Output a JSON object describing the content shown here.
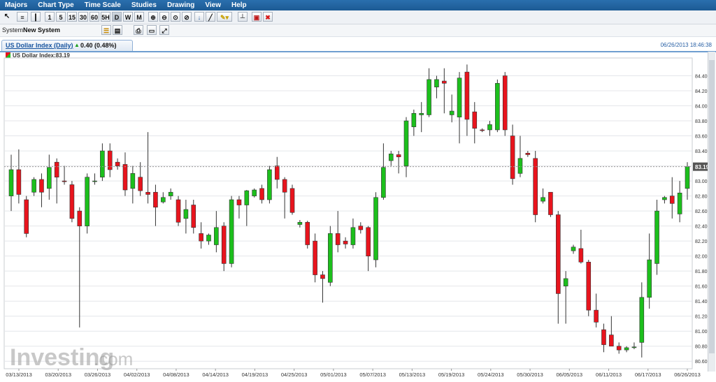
{
  "menu": [
    "Majors",
    "Chart Type",
    "Time Scale",
    "Studies",
    "Drawing",
    "View",
    "Help"
  ],
  "toolbar": {
    "periods": [
      "1",
      "5",
      "15",
      "30",
      "60",
      "5H",
      "D",
      "W",
      "M"
    ],
    "selected_period": "D"
  },
  "system": {
    "label": "System:",
    "value": "New System"
  },
  "tab": {
    "instrument": "US Dollar Index (Daily)",
    "change": "0.40 (0.48%)",
    "timestamp": "06/26/2013 18:46:38"
  },
  "legend": {
    "text": "US Dollar Index:83.19"
  },
  "watermark": {
    "brand": "Investing",
    "domain": ".com"
  },
  "colors": {
    "up": "#1cbf1c",
    "down": "#e8141d",
    "accent": "#1a56a0",
    "current_line": "#9a9a9a",
    "label_bg": "#555555"
  },
  "chart_data": {
    "type": "candlestick",
    "current_value": 83.19,
    "current_label": "83.19",
    "ylim": [
      80.5,
      84.6
    ],
    "y_ticks": [
      "84.40",
      "84.20",
      "84.00",
      "83.80",
      "83.60",
      "83.40",
      "83.20",
      "83.00",
      "82.80",
      "82.60",
      "82.40",
      "82.20",
      "82.00",
      "81.80",
      "81.60",
      "81.40",
      "81.20",
      "81.00",
      "80.80",
      "80.60"
    ],
    "x_ticks": [
      "03/13/2013",
      "03/20/2013",
      "03/26/2013",
      "04/02/2013",
      "04/08/2013",
      "04/14/2013",
      "04/19/2013",
      "04/25/2013",
      "05/01/2013",
      "05/07/2013",
      "05/13/2013",
      "05/19/2013",
      "05/24/2013",
      "05/30/2013",
      "06/05/2013",
      "06/11/2013",
      "06/17/2013",
      "06/26/2013"
    ],
    "candles": [
      {
        "o": 82.8,
        "h": 83.35,
        "l": 82.6,
        "c": 83.15
      },
      {
        "o": 83.15,
        "h": 83.42,
        "l": 82.7,
        "c": 82.82
      },
      {
        "o": 82.75,
        "h": 82.8,
        "l": 82.25,
        "c": 82.3
      },
      {
        "o": 82.85,
        "h": 83.05,
        "l": 82.8,
        "c": 83.02
      },
      {
        "o": 83.02,
        "h": 83.1,
        "l": 82.65,
        "c": 82.85
      },
      {
        "o": 82.9,
        "h": 83.35,
        "l": 82.75,
        "c": 83.18
      },
      {
        "o": 83.25,
        "h": 83.3,
        "l": 82.7,
        "c": 83.05
      },
      {
        "o": 83.0,
        "h": 83.2,
        "l": 82.95,
        "c": 82.99
      },
      {
        "o": 82.95,
        "h": 83.0,
        "l": 82.45,
        "c": 82.5
      },
      {
        "o": 82.6,
        "h": 82.65,
        "l": 81.05,
        "c": 82.4
      },
      {
        "o": 82.4,
        "h": 83.1,
        "l": 82.3,
        "c": 83.05
      },
      {
        "o": 83.0,
        "h": 83.1,
        "l": 82.95,
        "c": 83.0
      },
      {
        "o": 83.05,
        "h": 83.5,
        "l": 83.0,
        "c": 83.4
      },
      {
        "o": 83.4,
        "h": 83.5,
        "l": 83.05,
        "c": 83.15
      },
      {
        "o": 83.25,
        "h": 83.3,
        "l": 83.15,
        "c": 83.2
      },
      {
        "o": 83.22,
        "h": 83.38,
        "l": 82.8,
        "c": 82.88
      },
      {
        "o": 82.9,
        "h": 83.2,
        "l": 82.7,
        "c": 83.1
      },
      {
        "o": 83.05,
        "h": 83.25,
        "l": 82.8,
        "c": 82.87
      },
      {
        "o": 82.85,
        "h": 83.65,
        "l": 82.7,
        "c": 82.82
      },
      {
        "o": 82.85,
        "h": 82.95,
        "l": 82.4,
        "c": 82.65
      },
      {
        "o": 82.72,
        "h": 82.85,
        "l": 82.7,
        "c": 82.78
      },
      {
        "o": 82.8,
        "h": 82.9,
        "l": 82.75,
        "c": 82.85
      },
      {
        "o": 82.75,
        "h": 82.8,
        "l": 82.4,
        "c": 82.45
      },
      {
        "o": 82.5,
        "h": 82.75,
        "l": 82.3,
        "c": 82.62
      },
      {
        "o": 82.68,
        "h": 82.75,
        "l": 82.3,
        "c": 82.38
      },
      {
        "o": 82.3,
        "h": 82.45,
        "l": 82.1,
        "c": 82.2
      },
      {
        "o": 82.2,
        "h": 82.3,
        "l": 82.15,
        "c": 82.28
      },
      {
        "o": 82.15,
        "h": 82.6,
        "l": 82.05,
        "c": 82.38
      },
      {
        "o": 82.4,
        "h": 82.45,
        "l": 81.8,
        "c": 81.9
      },
      {
        "o": 81.9,
        "h": 82.8,
        "l": 81.85,
        "c": 82.75
      },
      {
        "o": 82.75,
        "h": 82.8,
        "l": 82.5,
        "c": 82.68
      },
      {
        "o": 82.68,
        "h": 82.88,
        "l": 82.4,
        "c": 82.87
      },
      {
        "o": 82.8,
        "h": 82.9,
        "l": 82.78,
        "c": 82.88
      },
      {
        "o": 82.9,
        "h": 82.95,
        "l": 82.7,
        "c": 82.75
      },
      {
        "o": 82.75,
        "h": 83.2,
        "l": 82.7,
        "c": 83.15
      },
      {
        "o": 83.2,
        "h": 83.32,
        "l": 82.9,
        "c": 83.02
      },
      {
        "o": 83.02,
        "h": 83.05,
        "l": 82.5,
        "c": 82.85
      },
      {
        "o": 82.9,
        "h": 82.95,
        "l": 82.55,
        "c": 82.58
      },
      {
        "o": 82.42,
        "h": 82.48,
        "l": 82.38,
        "c": 82.45
      },
      {
        "o": 82.45,
        "h": 82.47,
        "l": 82.1,
        "c": 82.15
      },
      {
        "o": 82.2,
        "h": 82.3,
        "l": 81.65,
        "c": 81.75
      },
      {
        "o": 81.75,
        "h": 81.8,
        "l": 81.38,
        "c": 81.7
      },
      {
        "o": 81.65,
        "h": 82.4,
        "l": 81.6,
        "c": 82.3
      },
      {
        "o": 82.3,
        "h": 82.6,
        "l": 82.05,
        "c": 82.15
      },
      {
        "o": 82.2,
        "h": 82.25,
        "l": 82.1,
        "c": 82.16
      },
      {
        "o": 82.15,
        "h": 82.5,
        "l": 82.1,
        "c": 82.38
      },
      {
        "o": 82.4,
        "h": 82.45,
        "l": 82.3,
        "c": 82.35
      },
      {
        "o": 82.38,
        "h": 82.4,
        "l": 81.8,
        "c": 82.0
      },
      {
        "o": 81.95,
        "h": 82.85,
        "l": 81.85,
        "c": 82.78
      },
      {
        "o": 82.78,
        "h": 83.5,
        "l": 82.75,
        "c": 83.18
      },
      {
        "o": 83.27,
        "h": 83.4,
        "l": 83.2,
        "c": 83.36
      },
      {
        "o": 83.35,
        "h": 83.4,
        "l": 83.1,
        "c": 83.32
      },
      {
        "o": 83.2,
        "h": 83.85,
        "l": 83.05,
        "c": 83.8
      },
      {
        "o": 83.72,
        "h": 83.95,
        "l": 83.6,
        "c": 83.9
      },
      {
        "o": 83.88,
        "h": 84.05,
        "l": 83.65,
        "c": 83.9
      },
      {
        "o": 83.88,
        "h": 84.5,
        "l": 83.85,
        "c": 84.35
      },
      {
        "o": 84.25,
        "h": 84.4,
        "l": 84.1,
        "c": 84.35
      },
      {
        "o": 84.33,
        "h": 84.5,
        "l": 83.9,
        "c": 84.3
      },
      {
        "o": 83.88,
        "h": 84.15,
        "l": 83.78,
        "c": 83.93
      },
      {
        "o": 83.85,
        "h": 84.45,
        "l": 83.5,
        "c": 84.37
      },
      {
        "o": 84.45,
        "h": 84.55,
        "l": 83.6,
        "c": 83.82
      },
      {
        "o": 83.92,
        "h": 84.05,
        "l": 83.5,
        "c": 83.7
      },
      {
        "o": 83.68,
        "h": 83.7,
        "l": 83.65,
        "c": 83.67
      },
      {
        "o": 83.68,
        "h": 83.8,
        "l": 83.6,
        "c": 83.75
      },
      {
        "o": 83.68,
        "h": 84.35,
        "l": 83.65,
        "c": 84.3
      },
      {
        "o": 84.4,
        "h": 84.45,
        "l": 83.6,
        "c": 83.68
      },
      {
        "o": 83.6,
        "h": 83.75,
        "l": 82.95,
        "c": 83.03
      },
      {
        "o": 83.1,
        "h": 83.6,
        "l": 83.05,
        "c": 83.3
      },
      {
        "o": 83.37,
        "h": 83.4,
        "l": 83.32,
        "c": 83.35
      },
      {
        "o": 83.3,
        "h": 83.4,
        "l": 82.45,
        "c": 82.55
      },
      {
        "o": 82.73,
        "h": 82.9,
        "l": 82.7,
        "c": 82.78
      },
      {
        "o": 82.85,
        "h": 82.85,
        "l": 82.52,
        "c": 82.55
      },
      {
        "o": 82.55,
        "h": 82.6,
        "l": 81.1,
        "c": 81.5
      },
      {
        "o": 81.6,
        "h": 81.8,
        "l": 81.1,
        "c": 81.7
      },
      {
        "o": 82.07,
        "h": 82.15,
        "l": 82.03,
        "c": 82.12
      },
      {
        "o": 82.1,
        "h": 82.35,
        "l": 81.9,
        "c": 81.92
      },
      {
        "o": 81.92,
        "h": 81.95,
        "l": 81.2,
        "c": 81.28
      },
      {
        "o": 81.28,
        "h": 81.5,
        "l": 81.05,
        "c": 81.12
      },
      {
        "o": 81.02,
        "h": 81.1,
        "l": 80.72,
        "c": 80.82
      },
      {
        "o": 80.95,
        "h": 81.2,
        "l": 80.8,
        "c": 80.8
      },
      {
        "o": 80.8,
        "h": 80.85,
        "l": 80.7,
        "c": 80.75
      },
      {
        "o": 80.75,
        "h": 80.8,
        "l": 80.72,
        "c": 80.78
      },
      {
        "o": 80.78,
        "h": 80.85,
        "l": 80.76,
        "c": 80.79
      },
      {
        "o": 80.85,
        "h": 81.65,
        "l": 80.65,
        "c": 81.45
      },
      {
        "o": 81.45,
        "h": 82.3,
        "l": 81.3,
        "c": 81.95
      },
      {
        "o": 81.9,
        "h": 82.75,
        "l": 81.75,
        "c": 82.6
      },
      {
        "o": 82.75,
        "h": 82.8,
        "l": 82.7,
        "c": 82.78
      },
      {
        "o": 82.8,
        "h": 83.05,
        "l": 82.5,
        "c": 82.7
      },
      {
        "o": 82.56,
        "h": 83.0,
        "l": 82.45,
        "c": 82.84
      },
      {
        "o": 82.9,
        "h": 83.25,
        "l": 82.75,
        "c": 83.19
      }
    ]
  }
}
